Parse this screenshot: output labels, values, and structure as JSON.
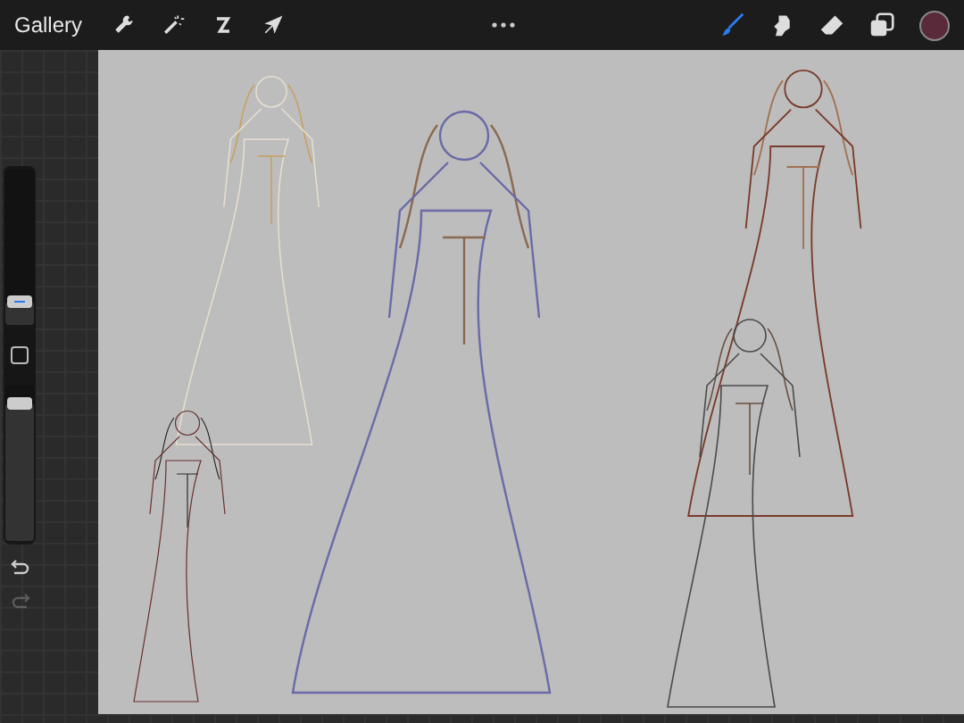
{
  "toolbar": {
    "gallery": "Gallery",
    "left_tools": [
      {
        "kind": "wrench"
      },
      {
        "kind": "wand"
      },
      {
        "kind": "selection"
      },
      {
        "kind": "transform"
      }
    ],
    "right_tools": [
      {
        "kind": "brush",
        "selected": true
      },
      {
        "kind": "smudge",
        "selected": false
      },
      {
        "kind": "eraser",
        "selected": false
      },
      {
        "kind": "layers",
        "selected": false
      }
    ],
    "color": "#5a2a3a"
  },
  "sidebar": {
    "brush_size": {
      "level": 0.15
    },
    "opacity": {
      "level": 0.88
    },
    "undo": {
      "disabled": false
    },
    "redo": {
      "disabled": true
    }
  }
}
